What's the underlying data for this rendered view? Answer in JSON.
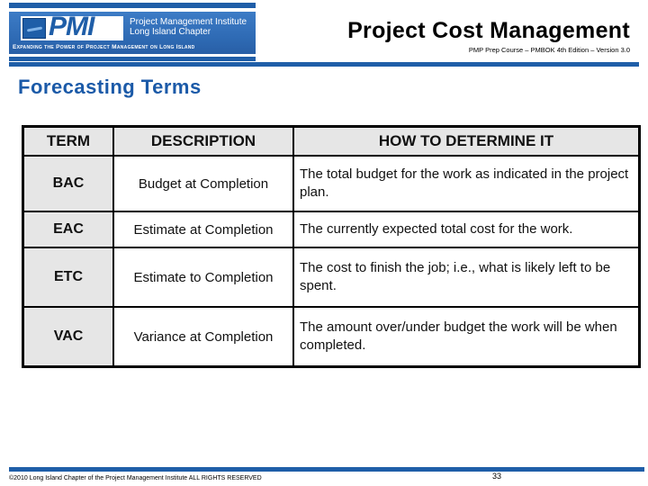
{
  "header": {
    "logo": {
      "letters": "PMI",
      "org_line1": "Project Management Institute",
      "org_line2": "Long Island Chapter",
      "tagline": "Expanding the Power of Project Management on Long Island",
      "brand_color": "#1f5ea8"
    },
    "title": "Project Cost Management",
    "subtitle": "PMP Prep Course – PMBOK 4th Edition – Version 3.0"
  },
  "section": {
    "title": "Forecasting Terms",
    "title_color": "#1b5aa8"
  },
  "table": {
    "columns": [
      "TERM",
      "DESCRIPTION",
      "HOW TO DETERMINE IT"
    ],
    "rows": [
      {
        "term": "BAC",
        "description": "Budget at Completion",
        "how": "The total budget for the work as indicated in the project plan."
      },
      {
        "term": "EAC",
        "description": "Estimate at Completion",
        "how": "The currently expected total cost for the work."
      },
      {
        "term": "ETC",
        "description": "Estimate to Completion",
        "how": "The cost to finish the job; i.e., what is likely left to be spent."
      },
      {
        "term": "VAC",
        "description": "Variance at Completion",
        "how": "The amount over/under budget the work will be when completed."
      }
    ]
  },
  "footer": {
    "copyright": "©2010 Long Island Chapter of the Project Management Institute  ALL RIGHTS RESERVED",
    "page_number": "33"
  }
}
